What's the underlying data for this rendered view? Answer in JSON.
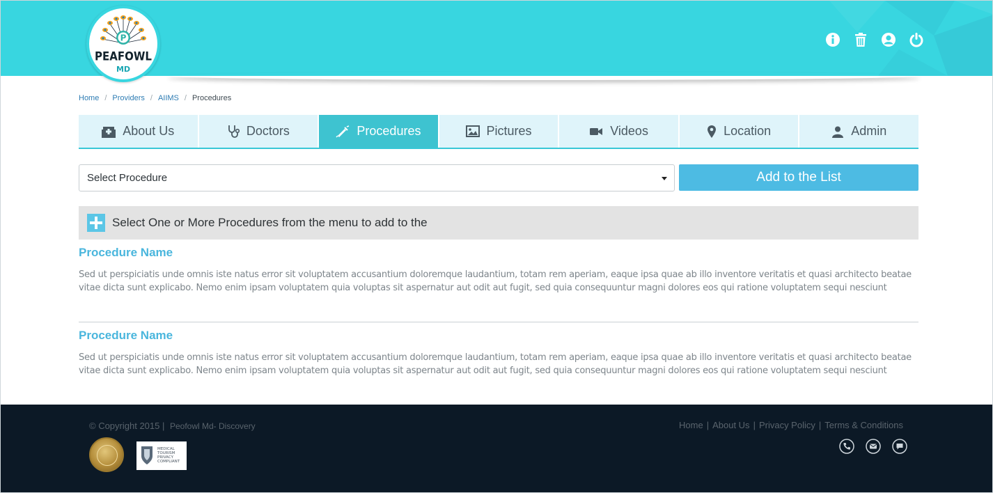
{
  "brand": {
    "name": "PEAFOWL",
    "sub": "MD",
    "logo_letter": "P"
  },
  "header": {
    "icons": [
      "info-icon",
      "trash-icon",
      "user-icon",
      "power-icon"
    ]
  },
  "breadcrumb": [
    "Home",
    "Providers",
    "AIIMS",
    "Procedures"
  ],
  "tabs": [
    {
      "label": "About Us",
      "icon": "hospital-icon"
    },
    {
      "label": "Doctors",
      "icon": "stethoscope-icon"
    },
    {
      "label": "Procedures",
      "icon": "syringe-icon",
      "active": true
    },
    {
      "label": "Pictures",
      "icon": "image-icon"
    },
    {
      "label": "Videos",
      "icon": "video-camera-icon"
    },
    {
      "label": "Location",
      "icon": "map-pin-icon"
    },
    {
      "label": "Admin",
      "icon": "admin-user-icon"
    }
  ],
  "procedure_select": {
    "selected": "Select Procedure"
  },
  "add_button": "Add to the List",
  "info_message": "Select One or More Procedures from the menu to add to the",
  "procedures": [
    {
      "name": "Procedure Name",
      "description": "Sed ut perspiciatis unde omnis iste natus error sit voluptatem accusantium doloremque laudantium, totam rem aperiam, eaque ipsa quae ab illo inventore veritatis et quasi architecto beatae vitae dicta sunt explicabo. Nemo enim ipsam voluptatem quia voluptas sit aspernatur aut odit aut fugit, sed quia consequuntur magni dolores eos qui ratione voluptatem sequi nesciunt"
    },
    {
      "name": "Procedure Name",
      "description": "Sed ut perspiciatis unde omnis iste natus error sit voluptatem accusantium doloremque laudantium, totam rem aperiam, eaque ipsa quae ab illo inventore veritatis et quasi architecto beatae vitae dicta sunt explicabo. Nemo enim ipsam voluptatem quia voluptas sit aspernatur aut odit aut fugit, sed quia consequuntur magni dolores eos qui ratione voluptatem sequi nesciunt"
    }
  ],
  "footer": {
    "copyright": "© Copyright 2015 |",
    "brand": "Peofowl Md- Discovery",
    "links": [
      "Home",
      "About Us",
      "Privacy Policy",
      "Terms & Conditions"
    ],
    "badge_text": "MEDICAL TOURISM PRIVACY COMPLIANT",
    "contact_icons": [
      "phone-icon",
      "mail-icon",
      "chat-icon"
    ]
  },
  "colors": {
    "header": "#38d6e0",
    "accent": "#4dbbe3",
    "active_tab": "#3ec3d0",
    "tab_bg": "#dff4fa",
    "footer": "#0c1926"
  }
}
